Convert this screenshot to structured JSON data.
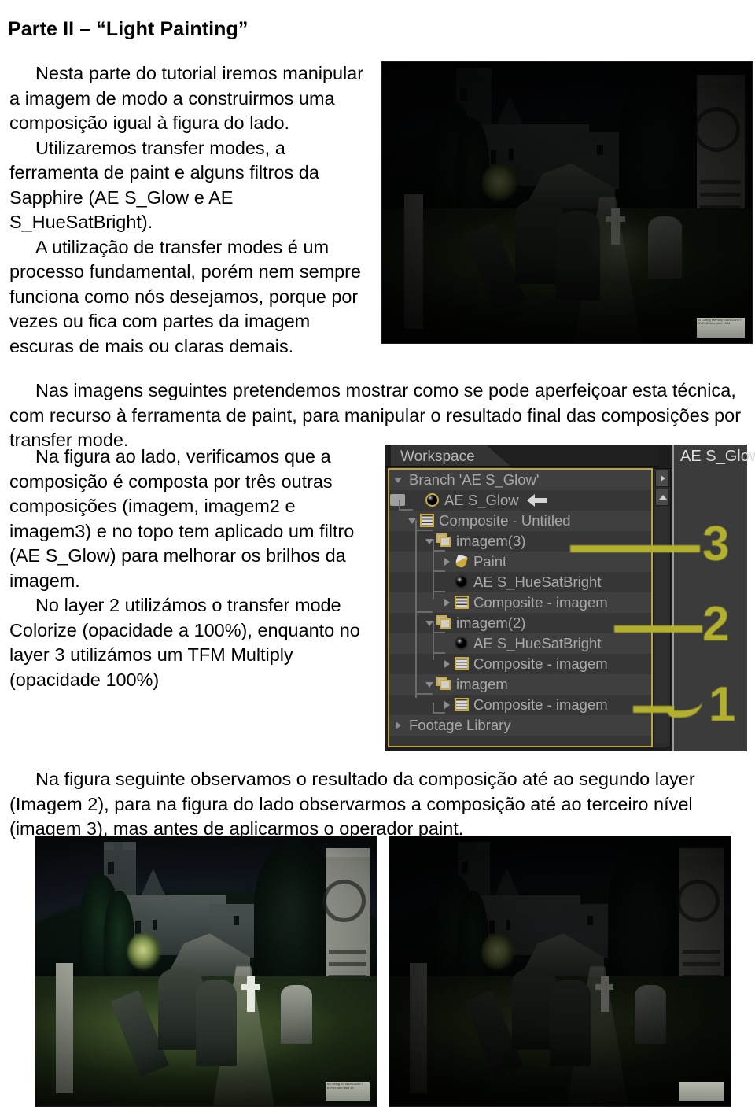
{
  "document": {
    "title": "Parte II – “Light Painting”",
    "paragraphs_col1": [
      "Nesta parte do tutorial iremos manipular a imagem de modo a construirmos uma composição igual à figura do lado.",
      "Utilizaremos transfer modes, a ferramenta de paint e alguns filtros da Sapphire (AE S_Glow e AE S_HueSatBright).",
      "A utilização de transfer modes é um processo fundamental, porém nem sempre funciona como nós desejamos, porque por vezes ou fica com partes da imagem escuras de mais ou claras demais."
    ],
    "paragraph_wide": "Nas imagens seguintes pretendemos mostrar como se pode aperfeiçoar esta técnica, com recurso à ferramenta de paint, para manipular o resultado final das composições por transfer mode.",
    "paragraphs_col2": [
      "Na figura ao lado, verificamos que a composição é composta por três outras composições (imagem, imagem2 e imagem3) e no topo tem aplicado um filtro (AE S_Glow) para melhorar os brilhos da imagem.",
      "No layer 2 utilizámos o transfer mode Colorize (opacidade a 100%), enquanto no layer 3 utilizámos um TFM Multiply (opacidade 100%)"
    ],
    "paragraph_bottom": "Na figura seguinte observamos o resultado da composição até ao segundo layer (Imagem 2), para na figura do lado observarmos a composição até ao terceiro nível (imagem 3), mas antes de aplicarmos o operador paint."
  },
  "ae_panel": {
    "tab_label": "Workspace",
    "right_panel_title": "AE S_Glow",
    "accent_color": "#c0a33c",
    "annotation_color": "#b3b02e",
    "background_color": "#3b3b3b",
    "text_color": "#a9a9a9",
    "tree": [
      {
        "label": "Branch 'AE S_Glow'",
        "depth": 0,
        "disclosure": "down",
        "icon": "none"
      },
      {
        "label": "AE S_Glow",
        "depth": 1,
        "disclosure": "blank",
        "icon": "sphere-icon",
        "marker": "square",
        "pointer": "arrow-left-icon"
      },
      {
        "label": "Composite - Untitled",
        "depth": 1,
        "disclosure": "down",
        "icon": "composite-icon"
      },
      {
        "label": "imagem(3)",
        "depth": 2,
        "disclosure": "down",
        "icon": "layer-icon"
      },
      {
        "label": "Paint",
        "depth": 3,
        "disclosure": "right",
        "icon": "brush-icon"
      },
      {
        "label": "AE S_HueSatBright",
        "depth": 3,
        "disclosure": "blank",
        "icon": "sphere-icon"
      },
      {
        "label": "Composite - imagem",
        "depth": 3,
        "disclosure": "right",
        "icon": "composite-icon"
      },
      {
        "label": "imagem(2)",
        "depth": 2,
        "disclosure": "down",
        "icon": "layer-icon"
      },
      {
        "label": "AE S_HueSatBright",
        "depth": 3,
        "disclosure": "blank",
        "icon": "sphere-icon"
      },
      {
        "label": "Composite - imagem",
        "depth": 3,
        "disclosure": "right",
        "icon": "composite-icon"
      },
      {
        "label": "imagem",
        "depth": 2,
        "disclosure": "down",
        "icon": "layer-icon"
      },
      {
        "label": "Composite - imagem",
        "depth": 3,
        "disclosure": "right",
        "icon": "composite-icon"
      },
      {
        "label": "Footage Library",
        "depth": 0,
        "disclosure": "right",
        "icon": "none"
      }
    ],
    "annotations": [
      {
        "text": "3",
        "target": "imagem(3)"
      },
      {
        "text": "2",
        "target": "imagem(2)"
      },
      {
        "text": "1",
        "target": "imagem"
      }
    ],
    "scrollbar": {
      "top_button_icon": "triangle-right-icon",
      "second_button_icon": "triangle-up-icon"
    }
  },
  "figures": {
    "top_right": {
      "caption_ref": "figura do lado",
      "description": "Composição final escura de cemitério com igreja em ruína ao luar",
      "plaque_text": "In Loving Memory\nMARGARET BYRNE\nwho died 1934"
    },
    "bottom_left": {
      "description": "Composição até ao segundo layer (Imagem 2)",
      "plaque_text": "In Loving M.\nMARGARET BYRN\nwho died 19"
    },
    "bottom_right": {
      "description": "Composição até ao terceiro nível (imagem 3), antes do operador paint",
      "plaque_text": ""
    }
  }
}
